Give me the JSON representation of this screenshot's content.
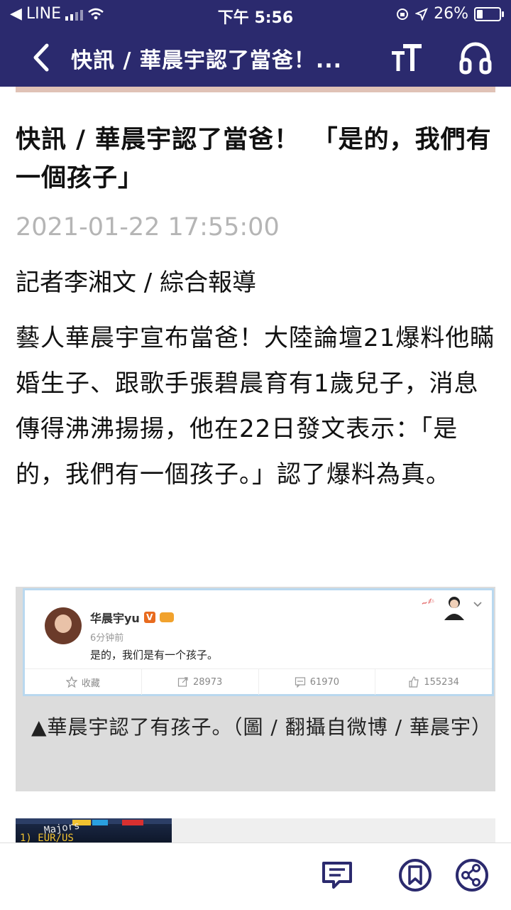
{
  "status_bar": {
    "back_app": "LINE",
    "time": "下午 5:56",
    "battery": "26%"
  },
  "nav": {
    "title": "快訊 / 華晨宇認了當爸！..."
  },
  "article": {
    "headline": "快訊 / 華晨宇認了當爸！　「是的，我們有一個孩子」",
    "date": "2021-01-22 17:55:00",
    "byline": "記者李湘文 / 綜合報導",
    "body": "藝人華晨宇宣布當爸！大陸論壇21爆料他瞞婚生子、跟歌手張碧晨育有1歲兒子，消息傳得沸沸揚揚，他在22日發文表示：「是的，我們有一個孩子。」認了爆料為真。"
  },
  "figure": {
    "weibo": {
      "user": "华晨宇yu",
      "time": "6分钟前",
      "text": "是的，我们是有一个孩子。",
      "favorite_label": "收藏",
      "reposts": "28973",
      "comments": "61970",
      "likes": "155234"
    },
    "caption": "▲華晨宇認了有孩子。（圖 / 翻攝自微博 / 華晨宇）"
  },
  "related": {
    "thumb_text_1": "Majors",
    "thumb_text_2": "1) EUR/US"
  },
  "colors": {
    "header_bg": "#2b2a6e",
    "accent_strip": "#e0c2b6",
    "date_gray": "#b5b5b5",
    "icon_purple": "#2b2a6e"
  },
  "icons": [
    "back-arrow-icon",
    "font-size-icon",
    "headphones-icon",
    "comment-icon",
    "bookmark-icon",
    "share-icon"
  ]
}
